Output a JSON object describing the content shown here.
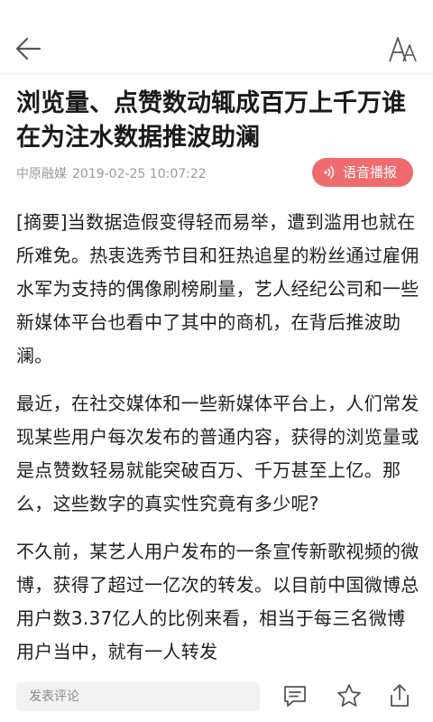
{
  "header": {
    "back_icon": "arrow-left-icon",
    "font_size_icon": "font-size-icon"
  },
  "article": {
    "title": "浏览量、点赞数动辄成百万上千万谁在为注水数据推波助澜",
    "source": "中原融媒",
    "datetime": "2019-02-25 10:07:22",
    "tts_label": "语音播报",
    "paragraphs": [
      "[摘要]当数据造假变得轻而易举，遭到滥用也就在所难免。热衷选秀节目和狂热追星的粉丝通过雇佣水军为支持的偶像刷榜刷量，艺人经纪公司和一些新媒体平台也看中了其中的商机，在背后推波助澜。",
      "最近，在社交媒体和一些新媒体平台上，人们常发现某些用户每次发布的普通内容，获得的浏览量或是点赞数轻易就能突破百万、千万甚至上亿。那么，这些数字的真实性究竟有多少呢?",
      "不久前，某艺人用户发布的一条宣传新歌视频的微博，获得了超过一亿次的转发。以目前中国微博总用户数3.37亿人的比例来看，相当于每三名微博用户当中，就有一人转发"
    ]
  },
  "bottom_bar": {
    "comment_placeholder": "发表评论",
    "comment_icon": "comment-icon",
    "favorite_icon": "star-icon",
    "share_icon": "share-icon"
  },
  "colors": {
    "accent": "#f06b6d",
    "text": "#1f1f1f",
    "meta": "#9a9a9a"
  }
}
